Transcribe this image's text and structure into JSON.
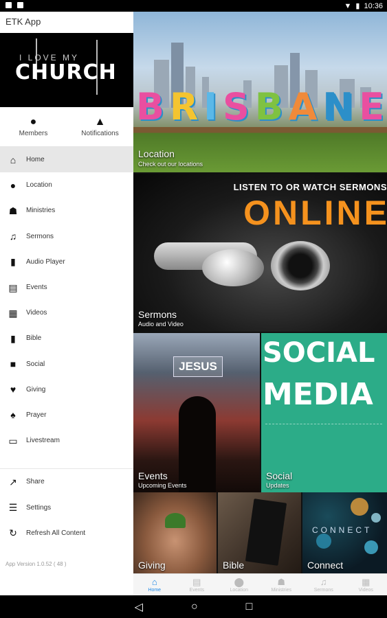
{
  "status_bar": {
    "time": "10:36"
  },
  "app": {
    "title": "ETK App",
    "logo_line1": "I LOVE MY",
    "logo_line2": "CHURCH"
  },
  "quick_actions": [
    {
      "label": "Members",
      "icon": "person-icon"
    },
    {
      "label": "Notifications",
      "icon": "bell-icon"
    }
  ],
  "menu": [
    {
      "label": "Home",
      "icon": "home-icon",
      "active": true
    },
    {
      "label": "Location",
      "icon": "location-pin-icon"
    },
    {
      "label": "Ministries",
      "icon": "group-icon"
    },
    {
      "label": "Sermons",
      "icon": "music-note-icon"
    },
    {
      "label": "Audio Player",
      "icon": "equalizer-icon"
    },
    {
      "label": "Events",
      "icon": "calendar-icon"
    },
    {
      "label": "Videos",
      "icon": "film-icon"
    },
    {
      "label": "Bible",
      "icon": "book-icon"
    },
    {
      "label": "Social",
      "icon": "chat-icon"
    },
    {
      "label": "Giving",
      "icon": "heart-icon"
    },
    {
      "label": "Prayer",
      "icon": "flame-icon"
    },
    {
      "label": "Livestream",
      "icon": "monitor-icon"
    }
  ],
  "secondary_menu": [
    {
      "label": "Share",
      "icon": "share-icon"
    },
    {
      "label": "Settings",
      "icon": "sliders-icon"
    },
    {
      "label": "Refresh All Content",
      "icon": "refresh-icon"
    }
  ],
  "version": "App Version 1.0.52 ( 48 )",
  "tiles": {
    "location": {
      "title": "Location",
      "subtitle": "Check out our locations",
      "image_text": "BRISBANE"
    },
    "sermons": {
      "title": "Sermons",
      "subtitle": "Audio and Video",
      "image_heading": "LISTEN TO OR WATCH SERMONS",
      "image_big": "ONLINE"
    },
    "events": {
      "title": "Events",
      "subtitle": "Upcoming Events",
      "image_text": "JESUS"
    },
    "social": {
      "title": "Social",
      "subtitle": "Updates",
      "image_line1": "SOCIAL",
      "image_line2": "MEDIA"
    },
    "giving": {
      "title": "Giving"
    },
    "bible": {
      "title": "Bible"
    },
    "connect": {
      "title": "Connect",
      "image_text": "CONNECT"
    }
  },
  "bottom_nav": [
    {
      "label": "Home",
      "icon": "home-icon",
      "active": true
    },
    {
      "label": "Events",
      "icon": "calendar-icon"
    },
    {
      "label": "Location",
      "icon": "location-pin-icon"
    },
    {
      "label": "Ministries",
      "icon": "group-icon"
    },
    {
      "label": "Sermons",
      "icon": "music-note-icon"
    },
    {
      "label": "Videos",
      "icon": "film-icon"
    }
  ],
  "colors": {
    "accent": "#1e88e5",
    "online_orange": "#f5921e",
    "social_green": "#2cac88"
  }
}
